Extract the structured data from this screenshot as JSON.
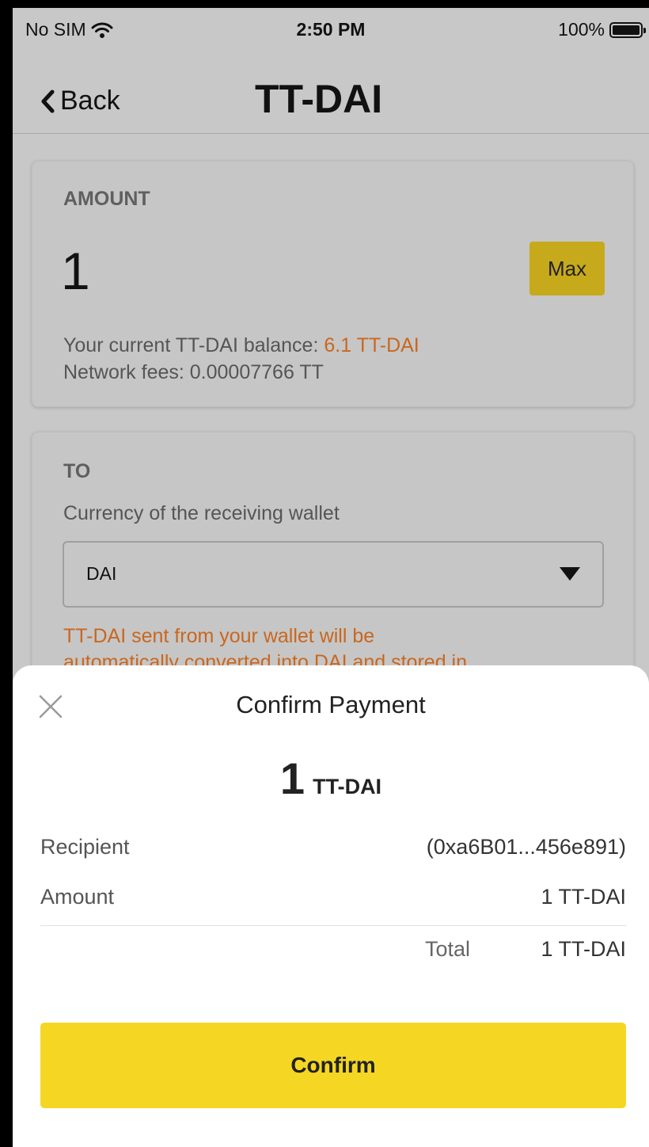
{
  "status_bar": {
    "carrier": "No SIM",
    "time": "2:50 PM",
    "battery_percent": "100%",
    "icons": [
      "wifi-icon",
      "battery-icon"
    ]
  },
  "nav": {
    "back_label": "Back",
    "title": "TT-DAI"
  },
  "amount_card": {
    "label": "AMOUNT",
    "value": "1",
    "max_label": "Max",
    "balance_prefix": "Your current TT-DAI balance: ",
    "balance_amount": "6.1 TT-DAI",
    "fees": "Network fees: 0.00007766 TT"
  },
  "to_card": {
    "label": "TO",
    "currency_hint": "Currency of the receiving wallet",
    "selected_currency": "DAI",
    "warning_line1": "TT-DAI sent from your wallet will be",
    "warning_line2": "automatically converted into DAI and stored in"
  },
  "confirm_sheet": {
    "title": "Confirm Payment",
    "amount_big": "1",
    "amount_unit": "TT-DAI",
    "recipient_label": "Recipient",
    "recipient_value": "(0xa6B01...456e891)",
    "amount_label": "Amount",
    "amount_value": "1 TT-DAI",
    "total_label": "Total",
    "total_value": "1 TT-DAI",
    "confirm_label": "Confirm",
    "close_icon": "close-icon"
  },
  "colors": {
    "accent_yellow": "#f5d623",
    "max_button": "#c7a91c",
    "orange_text": "#c9671f",
    "overlay_background": "#c8c8c8"
  }
}
